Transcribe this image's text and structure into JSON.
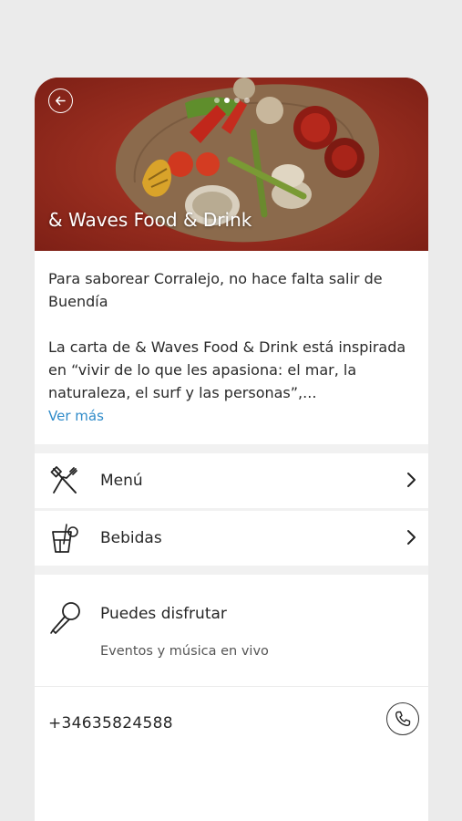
{
  "hero": {
    "title": "& Waves Food & Drink",
    "dots": 4,
    "active_dot": 2
  },
  "description": {
    "paragraph1": "Para saborear Corralejo, no hace falta salir de Buendía",
    "paragraph2": "La carta de & Waves Food & Drink está inspirada en “vivir de lo que les apasiona: el mar, la naturaleza, el surf y las personas”,...",
    "more_link": "Ver más"
  },
  "menu_rows": [
    {
      "label": "Menú",
      "icon": "utensils-icon"
    },
    {
      "label": "Bebidas",
      "icon": "drink-icon"
    }
  ],
  "enjoy": {
    "title": "Puedes disfrutar",
    "subtitle": "Eventos y música en vivo",
    "icon": "microphone-icon"
  },
  "contact": {
    "phone": "+34635824588",
    "icon": "phone-icon"
  },
  "colors": {
    "accent_link": "#2f8bc9",
    "hero_bg": "#9a2a1e",
    "page_bg": "#ebebeb"
  }
}
